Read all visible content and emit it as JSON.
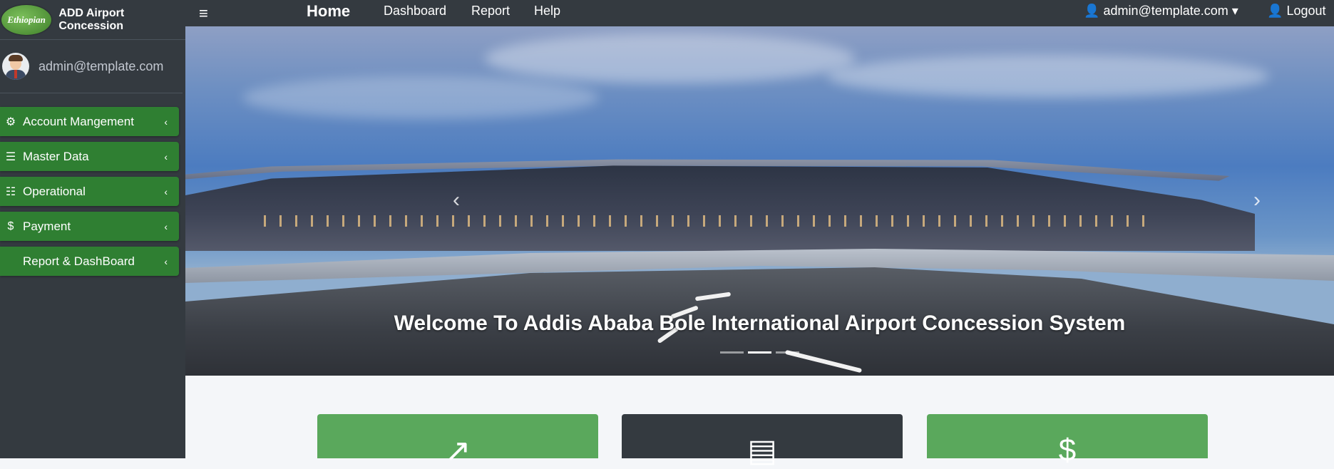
{
  "brand": {
    "logo_text": "Ethiopian",
    "title": "ADD Airport Concession"
  },
  "user": {
    "email": "admin@template.com"
  },
  "sidebar": {
    "items": [
      {
        "label": "Account Mangement",
        "icon": "cogs-icon",
        "glyph": "⚙"
      },
      {
        "label": "Master Data",
        "icon": "database-icon",
        "glyph": "☰"
      },
      {
        "label": "Operational",
        "icon": "tasks-icon",
        "glyph": "☷"
      },
      {
        "label": "Payment",
        "icon": "dollar-icon",
        "glyph": "$"
      },
      {
        "label": "Report & DashBoard",
        "icon": "",
        "glyph": ""
      }
    ],
    "chevron": "‹"
  },
  "topbar": {
    "menu_glyph": "≡",
    "home": "Home",
    "links": [
      "Dashboard",
      "Report",
      "Help"
    ],
    "user_email": "admin@template.com",
    "logout": "Logout"
  },
  "carousel": {
    "caption": "Welcome To Addis Ababa Bole International Airport Concession System",
    "prev_glyph": "‹",
    "next_glyph": "›",
    "slides": 3,
    "active_slide": 2
  },
  "cards": [
    {
      "icon": "chart-line-icon",
      "glyph": "↗",
      "color": "#5aa85c"
    },
    {
      "icon": "newspaper-icon",
      "glyph": "▤",
      "color": "#343a40"
    },
    {
      "icon": "dollar-icon",
      "glyph": "$",
      "color": "#5aa85c"
    }
  ],
  "colors": {
    "sidebar": "#343a40",
    "nav_item": "#2f7f32",
    "accent_green": "#5aa85c"
  }
}
